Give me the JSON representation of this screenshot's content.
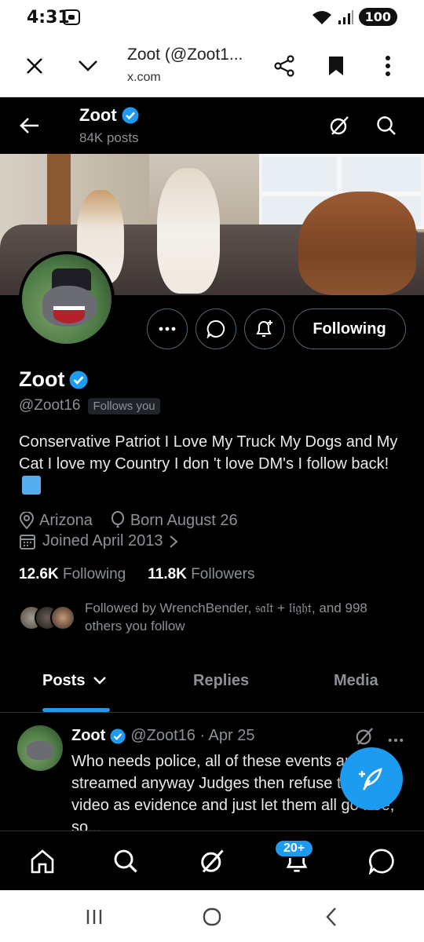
{
  "status_bar": {
    "time": "4:31",
    "battery": "100"
  },
  "browser": {
    "title": "Zoot (@Zoot1...",
    "url": "x.com"
  },
  "header": {
    "name": "Zoot",
    "posts_count": "84K posts"
  },
  "actions": {
    "following_label": "Following"
  },
  "profile": {
    "name": "Zoot",
    "handle": "@Zoot16",
    "follows_you": "Follows you",
    "bio": "Conservative Patriot I Love My Truck My Dogs and My Cat I love my Country I don 't love DM's I follow back!",
    "location": "Arizona",
    "birthday": "Born August 26",
    "joined": "Joined April 2013",
    "following_count": "12.6K",
    "following_label": "Following",
    "followers_count": "11.8K",
    "followers_label": "Followers",
    "followed_by": "Followed by WrenchBender, 𝔰𝔞𝔩𝔱 + 𝔩𝔦𝔤𝔥𝔱, and 998 others you follow"
  },
  "tabs": [
    {
      "label": "Posts",
      "active": true
    },
    {
      "label": "Replies",
      "active": false
    },
    {
      "label": "Media",
      "active": false
    }
  ],
  "tweet": {
    "name": "Zoot",
    "handle_date": "@Zoot16 · Apr 25",
    "text": "Who needs police, all of these events are live streamed anyway Judges then refuse to admit video as evidence and just let them all go free, so..."
  },
  "bottom_nav": {
    "items": [
      "home-icon",
      "search-icon",
      "grok-icon",
      "notifications-icon",
      "messages-icon"
    ],
    "notif_badge": "20+"
  },
  "colors": {
    "accent": "#1d9bf0",
    "background": "#000000",
    "muted": "#8b9197",
    "verified": "#1d9bf0"
  }
}
